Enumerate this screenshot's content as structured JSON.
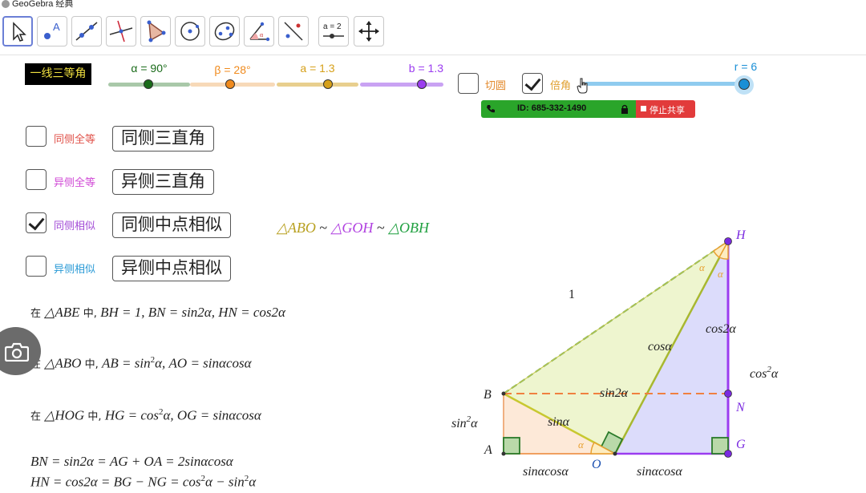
{
  "window": {
    "title": "GeoGebra 经典"
  },
  "toolbar": {
    "tools": [
      {
        "name": "move-tool-icon",
        "active": true
      },
      {
        "name": "point-tool-icon"
      },
      {
        "name": "line-tool-icon"
      },
      {
        "name": "perpendicular-tool-icon"
      },
      {
        "name": "polygon-tool-icon"
      },
      {
        "name": "circle-tool-icon"
      },
      {
        "name": "ellipse-tool-icon"
      },
      {
        "name": "angle-tool-icon"
      },
      {
        "name": "reflect-tool-icon"
      },
      {
        "name": "slider-tool-icon",
        "text": "a = 2"
      },
      {
        "name": "move-view-tool-icon"
      }
    ]
  },
  "title_box": {
    "label": "一线三等角"
  },
  "sliders": {
    "alpha": {
      "label": "α = 90°",
      "value": 90,
      "color": "#1a6b1a",
      "track": "#a9c8a9"
    },
    "beta": {
      "label": "β = 28°",
      "value": 28,
      "color": "#f08a1c",
      "track": "#f7d9b8"
    },
    "a": {
      "label": "a = 1.3",
      "value": 1.3,
      "color": "#d6a01a",
      "track": "#e8cf8e"
    },
    "b": {
      "label": "b = 1.3",
      "value": 1.3,
      "color": "#9b3cf0",
      "track": "#c9a2f3"
    },
    "r": {
      "label": "r = 6",
      "value": 6,
      "color": "#1a8fd6",
      "track": "#8fcbef"
    }
  },
  "checkboxes": {
    "tangent_circle": {
      "label": "切圆",
      "checked": false,
      "color": "#e38a2c"
    },
    "double_angle": {
      "label": "倍角",
      "checked": true,
      "color": "#e0a030"
    }
  },
  "share": {
    "id_text": "ID: 685-332-1490",
    "stop_label": "停止共享"
  },
  "cases": [
    {
      "label": "同侧全等",
      "checked": false,
      "color": "#e0524a",
      "button": "同侧三直角"
    },
    {
      "label": "异侧全等",
      "checked": false,
      "color": "#d04ad6",
      "button": "异侧三直角"
    },
    {
      "label": "同侧相似",
      "checked": true,
      "color": "#a24ad6",
      "button": "同侧中点相似"
    },
    {
      "label": "异侧相似",
      "checked": false,
      "color": "#2a9ad6",
      "button": "异侧中点相似"
    }
  ],
  "similarity": {
    "t1": "△ABO",
    "sim1": " ~ ",
    "t2": "△GOH",
    "sim2": " ~ ",
    "t3": "△OBH",
    "c1": "#b8a020",
    "c2": "#b040e0",
    "c3": "#20a040"
  },
  "formulas": {
    "f1": {
      "zai": "在",
      "tri": "△ABE",
      "zhong": "中,",
      "body": "BH = 1, BN = sin2α, HN = cos2α"
    },
    "f2": {
      "zai": "在",
      "tri": "△ABO",
      "zhong": "中,",
      "body_pre": "AB = sin",
      "sup": "2",
      "body_post": "α, AO = sinαcosα"
    },
    "f3": {
      "zai": "在",
      "tri": "△HOG",
      "zhong": "中,",
      "body_pre": "HG = cos",
      "sup": "2",
      "body_post": "α, OG = sinαcosα"
    },
    "f4": {
      "text": "BN = sin2α = AG + OA = 2sinαcosα"
    },
    "f5": {
      "pre": "HN = cos2α = BG − NG = cos",
      "sup1": "2",
      "mid": "α − sin",
      "sup2": "2",
      "post": "α"
    }
  },
  "figure": {
    "one_label": "1",
    "points": {
      "H": "H",
      "B": "B",
      "N": "N",
      "A": "A",
      "O": "O",
      "G": "G"
    },
    "labels": {
      "cos2a": "cos2α",
      "cos2a_outer": "cos",
      "cos2a_outer_sup": "2",
      "cos2a_outer_post": "α",
      "cosa": "cosα",
      "sin2a_dash": "sin2α",
      "sina": "sinα",
      "sin2a_left": "sin",
      "sin2a_left_sup": "2",
      "sin2a_left_post": "α",
      "ao": "sinαcosα",
      "og": "sinαcosα",
      "alpha_h1": "α",
      "alpha_h2": "α",
      "alpha_o": "α"
    }
  }
}
